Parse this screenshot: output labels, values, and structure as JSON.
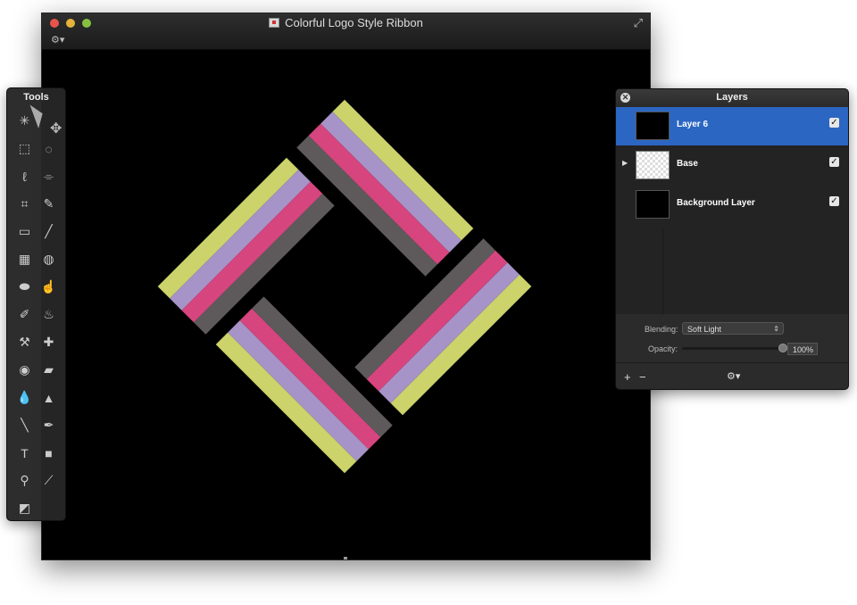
{
  "window": {
    "title": "Colorful Logo Style Ribbon",
    "gear_label": "⚙▾",
    "fullscreen_label": "⤢"
  },
  "tools": {
    "title": "Tools",
    "items": [
      {
        "name": "magic-wand-tool-icon",
        "glyph": "✳"
      },
      {
        "name": "move-tool-icon",
        "glyph": ""
      },
      {
        "name": "rect-select-tool-icon",
        "glyph": "⬚"
      },
      {
        "name": "ellipse-select-tool-icon",
        "glyph": "◌"
      },
      {
        "name": "lasso-tool-icon",
        "glyph": "ℓ"
      },
      {
        "name": "polygon-lasso-tool-icon",
        "glyph": "⌯"
      },
      {
        "name": "crop-tool-icon",
        "glyph": "⌗"
      },
      {
        "name": "pencil-tool-icon",
        "glyph": "✎"
      },
      {
        "name": "eraser-tool-icon",
        "glyph": "▭"
      },
      {
        "name": "brush-tool-icon",
        "glyph": "╱"
      },
      {
        "name": "pixel-grid-tool-icon",
        "glyph": "▦"
      },
      {
        "name": "paint-bucket-tool-icon",
        "glyph": "◍"
      },
      {
        "name": "sponge-tool-icon",
        "glyph": "⬬"
      },
      {
        "name": "smudge-tool-icon",
        "glyph": "☝"
      },
      {
        "name": "broom-tool-icon",
        "glyph": "✐"
      },
      {
        "name": "burn-tool-icon",
        "glyph": "♨"
      },
      {
        "name": "stamp-tool-icon",
        "glyph": "⚒"
      },
      {
        "name": "heal-bandage-tool-icon",
        "glyph": "✚"
      },
      {
        "name": "red-eye-tool-icon",
        "glyph": "◉"
      },
      {
        "name": "dodge-eraser-tool-icon",
        "glyph": "▰"
      },
      {
        "name": "blur-drop-tool-icon",
        "glyph": "💧"
      },
      {
        "name": "sharpen-tool-icon",
        "glyph": "▲"
      },
      {
        "name": "pen-tool-icon",
        "glyph": "╲"
      },
      {
        "name": "vector-pen-tool-icon",
        "glyph": "✒"
      },
      {
        "name": "text-tool-icon",
        "glyph": "T"
      },
      {
        "name": "shape-tool-icon",
        "glyph": "■"
      },
      {
        "name": "zoom-tool-icon",
        "glyph": "⚲"
      },
      {
        "name": "eyedropper-tool-icon",
        "glyph": "⟋"
      },
      {
        "name": "gradient-tool-icon",
        "glyph": "◩"
      }
    ]
  },
  "layers": {
    "title": "Layers",
    "close_label": "✕",
    "rows": [
      {
        "name": "Layer 6",
        "visible_mark": "✓"
      },
      {
        "name": "Base",
        "visible_mark": "✓",
        "disclosure": "▶"
      },
      {
        "name": "Background Layer",
        "visible_mark": "✓"
      }
    ],
    "blending_label": "Blending:",
    "blending_value": "Soft Light",
    "opacity_label": "Opacity:",
    "opacity_value": "100%",
    "add_label": "+",
    "remove_label": "−",
    "gear_label": "⚙▾"
  },
  "colors": {
    "yellow_band": "#cbd36a",
    "lavender_band": "#a693c8",
    "magenta_band": "#d7457f",
    "gray_band": "#5e5a5c",
    "selection_blue": "#2c66c3"
  }
}
